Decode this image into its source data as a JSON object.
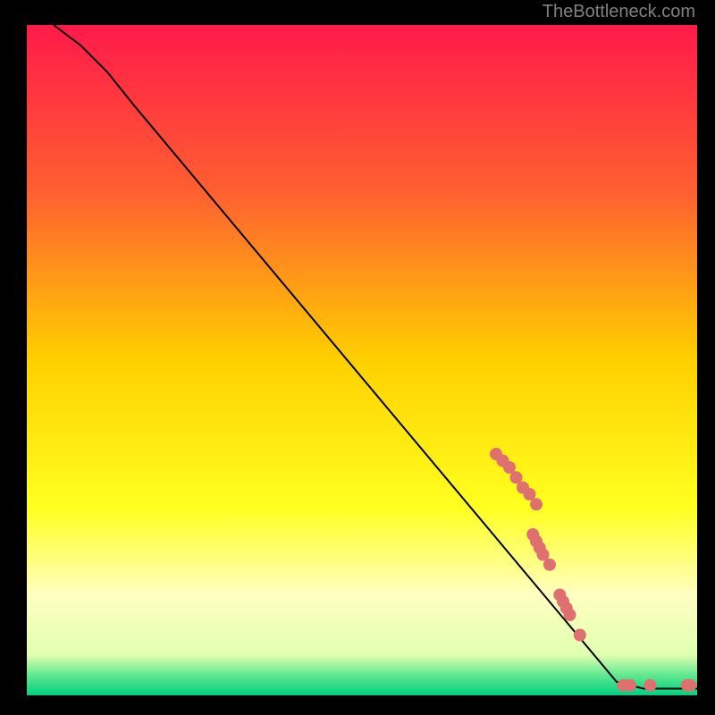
{
  "attribution": "TheBottleneck.com",
  "chart_data": {
    "type": "line",
    "title": "",
    "xlabel": "",
    "ylabel": "",
    "xlim": [
      0,
      100
    ],
    "ylim": [
      0,
      100
    ],
    "curve": [
      {
        "x": 4,
        "y": 100
      },
      {
        "x": 8,
        "y": 97
      },
      {
        "x": 12,
        "y": 93
      },
      {
        "x": 16,
        "y": 88
      },
      {
        "x": 88,
        "y": 2
      },
      {
        "x": 92,
        "y": 1
      },
      {
        "x": 100,
        "y": 1
      }
    ],
    "markers": [
      {
        "x": 70,
        "y": 36
      },
      {
        "x": 71,
        "y": 35
      },
      {
        "x": 72,
        "y": 34
      },
      {
        "x": 73,
        "y": 32.5
      },
      {
        "x": 74,
        "y": 31
      },
      {
        "x": 75,
        "y": 30
      },
      {
        "x": 76,
        "y": 28.5
      },
      {
        "x": 75.5,
        "y": 24
      },
      {
        "x": 76,
        "y": 23
      },
      {
        "x": 76.5,
        "y": 22
      },
      {
        "x": 77,
        "y": 21
      },
      {
        "x": 78,
        "y": 19.5
      },
      {
        "x": 79.5,
        "y": 15
      },
      {
        "x": 80,
        "y": 14
      },
      {
        "x": 80.5,
        "y": 13
      },
      {
        "x": 81,
        "y": 12
      },
      {
        "x": 82.5,
        "y": 9
      },
      {
        "x": 89,
        "y": 1.5
      },
      {
        "x": 90,
        "y": 1.5
      },
      {
        "x": 93,
        "y": 1.5
      },
      {
        "x": 98.5,
        "y": 1.5
      },
      {
        "x": 99,
        "y": 1.5
      }
    ],
    "marker_color": "#e07070",
    "gradient_stops": [
      {
        "offset": 0,
        "color": "#ff1a4a"
      },
      {
        "offset": 25,
        "color": "#ff6030"
      },
      {
        "offset": 50,
        "color": "#ffd000"
      },
      {
        "offset": 72,
        "color": "#ffff20"
      },
      {
        "offset": 85,
        "color": "#ffffc0"
      },
      {
        "offset": 94,
        "color": "#e0ffb0"
      },
      {
        "offset": 97,
        "color": "#60e890"
      },
      {
        "offset": 100,
        "color": "#00d080"
      }
    ]
  }
}
